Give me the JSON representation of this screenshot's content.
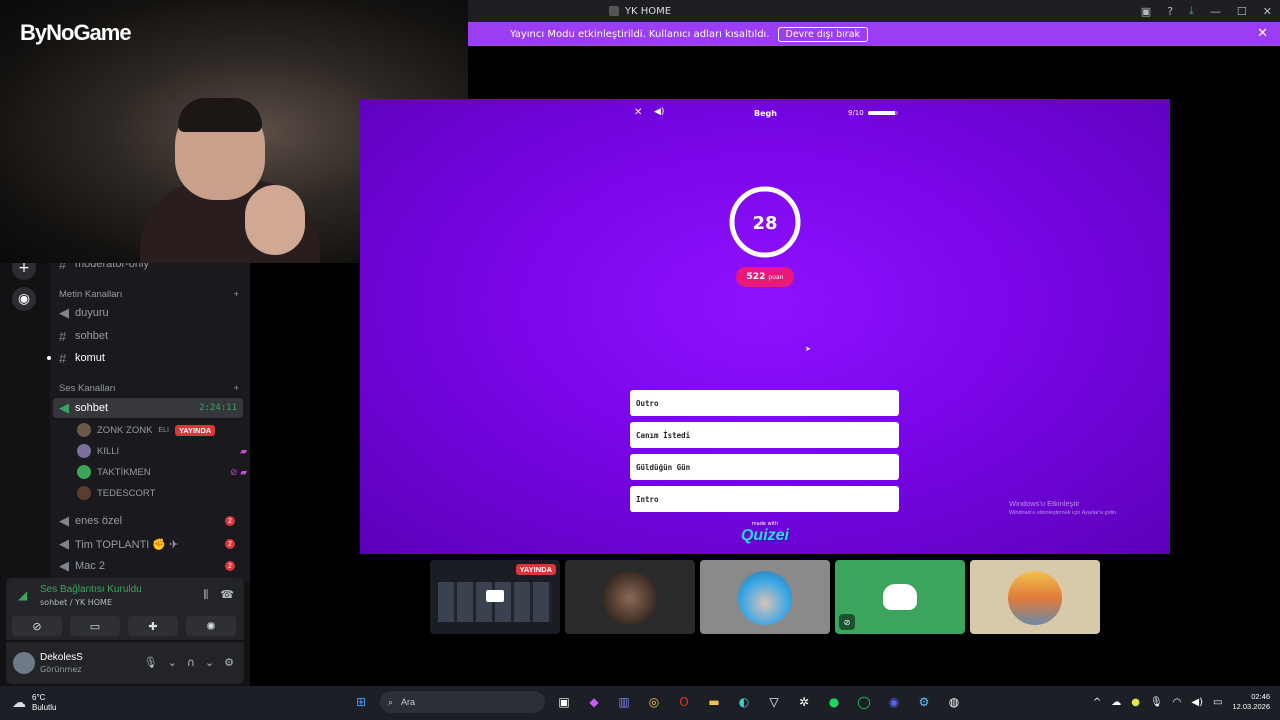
{
  "titlebar": {
    "title": "YK HOME"
  },
  "banner": {
    "text": "Yayıncı Modu etkinleştirildi. Kullanıcı adları kısaltıldı.",
    "button": "Devre dışı bırak"
  },
  "webcam": {
    "logo_prefix": "",
    "logo": "ByNoGame"
  },
  "sidebar": {
    "partial_channel": "moderatör-only",
    "text_category": "Metin Kanalları",
    "text_channels": [
      "duyuru",
      "sohbet",
      "komut"
    ],
    "voice_category": "Ses Kanalları",
    "active_voice": {
      "name": "sohbet",
      "time": "2:24:11"
    },
    "voice_users": [
      {
        "name": "ZONK ZONK",
        "tag": "ELI",
        "live": "YAYINDA"
      },
      {
        "name": "KILLI"
      },
      {
        "name": "TAKTİKMEN"
      },
      {
        "name": "TEDESCORT"
      }
    ],
    "other_voice": [
      {
        "name": "enes özel",
        "badge": "2"
      },
      {
        "name": "Tim TOPLANTI ✊ ✈",
        "badge": "2"
      },
      {
        "name": "Mac 2",
        "badge": "2"
      }
    ]
  },
  "voice_panel": {
    "status": "Ses Bağlantısı Kuruldu",
    "channel": "sohbet / YK HOME"
  },
  "user": {
    "name": "DekolesS",
    "status": "Görünmez"
  },
  "quiz": {
    "player": "Begh",
    "progress": "9/10",
    "progress_fraction": 0.9,
    "timer": "28",
    "score": "522",
    "score_unit": "puan",
    "answers": [
      "Outro",
      "Canım İstedi",
      "Güldüğün Gün",
      "Intro"
    ],
    "made_with": "made with",
    "brand": "Quizei"
  },
  "watermark": {
    "title": "Windows'u Etkinleştir",
    "sub": "Windows'u etkinleştirmek için Ayarlar'a gidin."
  },
  "tiles": {
    "live": "YAYINDA"
  },
  "taskbar": {
    "temp": "6°C",
    "weather": "Bulutlu",
    "search_placeholder": "Ara",
    "time": "02:46",
    "date": "12.03.2026"
  },
  "colors": {
    "banner": "#9b3df2",
    "quiz_bg": "#7a06e8",
    "score": "#e8197a",
    "discord_green": "#3ba55d",
    "live_red": "#da373c"
  }
}
